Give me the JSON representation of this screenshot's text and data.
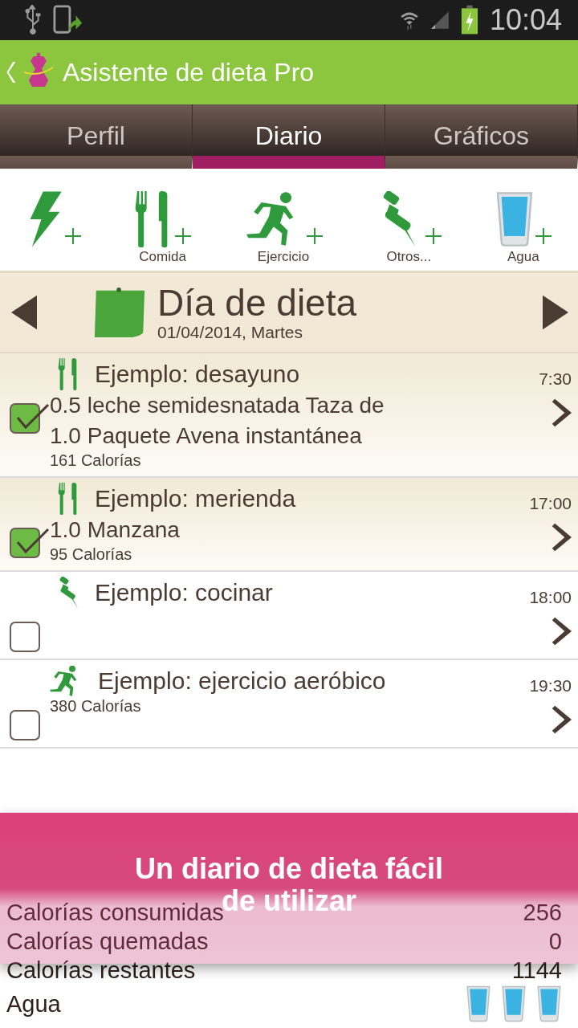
{
  "status_bar": {
    "time": "10:04"
  },
  "app_bar": {
    "title": "Asistente de dieta Pro"
  },
  "tabs": [
    {
      "label": "Perfil",
      "selected": false
    },
    {
      "label": "Diario",
      "selected": true
    },
    {
      "label": "Gráficos",
      "selected": false
    }
  ],
  "quick_add": [
    {
      "kind": "bolt"
    },
    {
      "kind": "food",
      "label": "Comida"
    },
    {
      "kind": "exercise",
      "label": "Ejercicio"
    },
    {
      "kind": "pin",
      "label": "Otros..."
    },
    {
      "kind": "water",
      "label": "Agua"
    }
  ],
  "day_header": {
    "title": "Día de dieta",
    "date": "01/04/2014, Martes"
  },
  "entries": [
    {
      "kind": "food",
      "title": "Ejemplo: desayuno",
      "time": "7:30",
      "checked": true,
      "lines": [
        "0.5 leche semidesnatada Taza de",
        "1.0 Paquete Avena instantánea"
      ],
      "calories": "161 Calorías"
    },
    {
      "kind": "food",
      "title": "Ejemplo: merienda",
      "time": "17:00",
      "checked": true,
      "lines": [
        "1.0  Manzana"
      ],
      "calories": "95 Calorías"
    },
    {
      "kind": "pin",
      "title": "Ejemplo: cocinar",
      "time": "18:00",
      "checked": false
    },
    {
      "kind": "exercise",
      "title": "Ejemplo: ejercicio aeróbico",
      "time": "19:30",
      "checked": false,
      "calories": "380 Calorías"
    }
  ],
  "summary": [
    {
      "label": "Calorías consumidas",
      "value": "256"
    },
    {
      "label": "Calorías quemadas",
      "value": "0"
    },
    {
      "label": "Calorías restantes",
      "value": "1144"
    }
  ],
  "water": {
    "label": "Agua",
    "glasses": [
      {
        "filled": true
      },
      {
        "filled": true
      },
      {
        "filled": true
      }
    ]
  },
  "banner": {
    "lines": [
      "Un diario de dieta fácil",
      "de utilizar"
    ]
  }
}
